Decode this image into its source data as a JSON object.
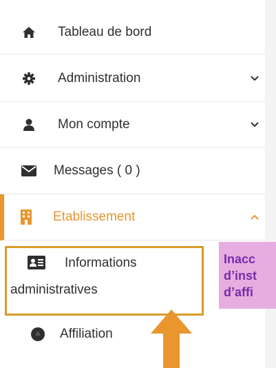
{
  "sidebar": {
    "items": [
      {
        "label": "Tableau de bord",
        "icon": "home-icon"
      },
      {
        "label": "Administration",
        "icon": "gear-icon"
      },
      {
        "label": "Mon compte",
        "icon": "user-icon"
      },
      {
        "label": "Messages ( 0 )",
        "icon": "envelope-icon"
      },
      {
        "label": "Etablissement",
        "icon": "building-icon"
      }
    ],
    "subitems": {
      "informations_line1": "Informations",
      "informations_line2": "administratives",
      "affiliation": "Affiliation"
    }
  },
  "callout": {
    "lines": [
      "Inacc",
      "d’inst",
      "d’affi"
    ]
  },
  "colors": {
    "accent": "#e8962d",
    "callout_bg": "#e6aee0",
    "callout_text": "#7b2aa8",
    "icon": "#2f2f2f"
  }
}
